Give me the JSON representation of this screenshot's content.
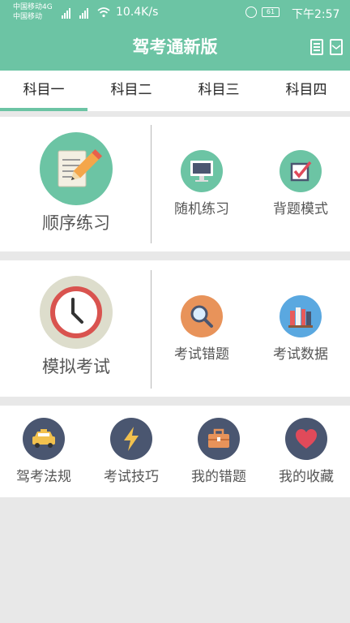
{
  "status_bar": {
    "carrier_1": "中国移动4G",
    "carrier_2": "中国移动",
    "network_speed": "10.4K/s",
    "battery_level": "61",
    "time": "下午2:57"
  },
  "header": {
    "title": "驾考通新版",
    "icons": [
      "book-icon",
      "envelope-icon"
    ]
  },
  "tabs": [
    {
      "label": "科目一",
      "active": true
    },
    {
      "label": "科目二",
      "active": false
    },
    {
      "label": "科目三",
      "active": false
    },
    {
      "label": "科目四",
      "active": false
    }
  ],
  "practice_section": {
    "main": {
      "label": "顺序练习",
      "icon": "pencil-notepad-icon"
    },
    "items": [
      {
        "label": "随机练习",
        "icon": "monitor-icon"
      },
      {
        "label": "背题模式",
        "icon": "checkbox-icon"
      }
    ]
  },
  "exam_section": {
    "main": {
      "label": "模拟考试",
      "icon": "clock-icon"
    },
    "items": [
      {
        "label": "考试错题",
        "icon": "magnifier-icon"
      },
      {
        "label": "考试数据",
        "icon": "books-icon"
      }
    ]
  },
  "bottom_row": [
    {
      "label": "驾考法规",
      "icon": "car-icon"
    },
    {
      "label": "考试技巧",
      "icon": "lightning-icon"
    },
    {
      "label": "我的错题",
      "icon": "briefcase-icon"
    },
    {
      "label": "我的收藏",
      "icon": "heart-icon"
    }
  ],
  "colors": {
    "brand": "#6cc4a4",
    "background": "#e8e8e8",
    "navy": "#4a5670"
  }
}
